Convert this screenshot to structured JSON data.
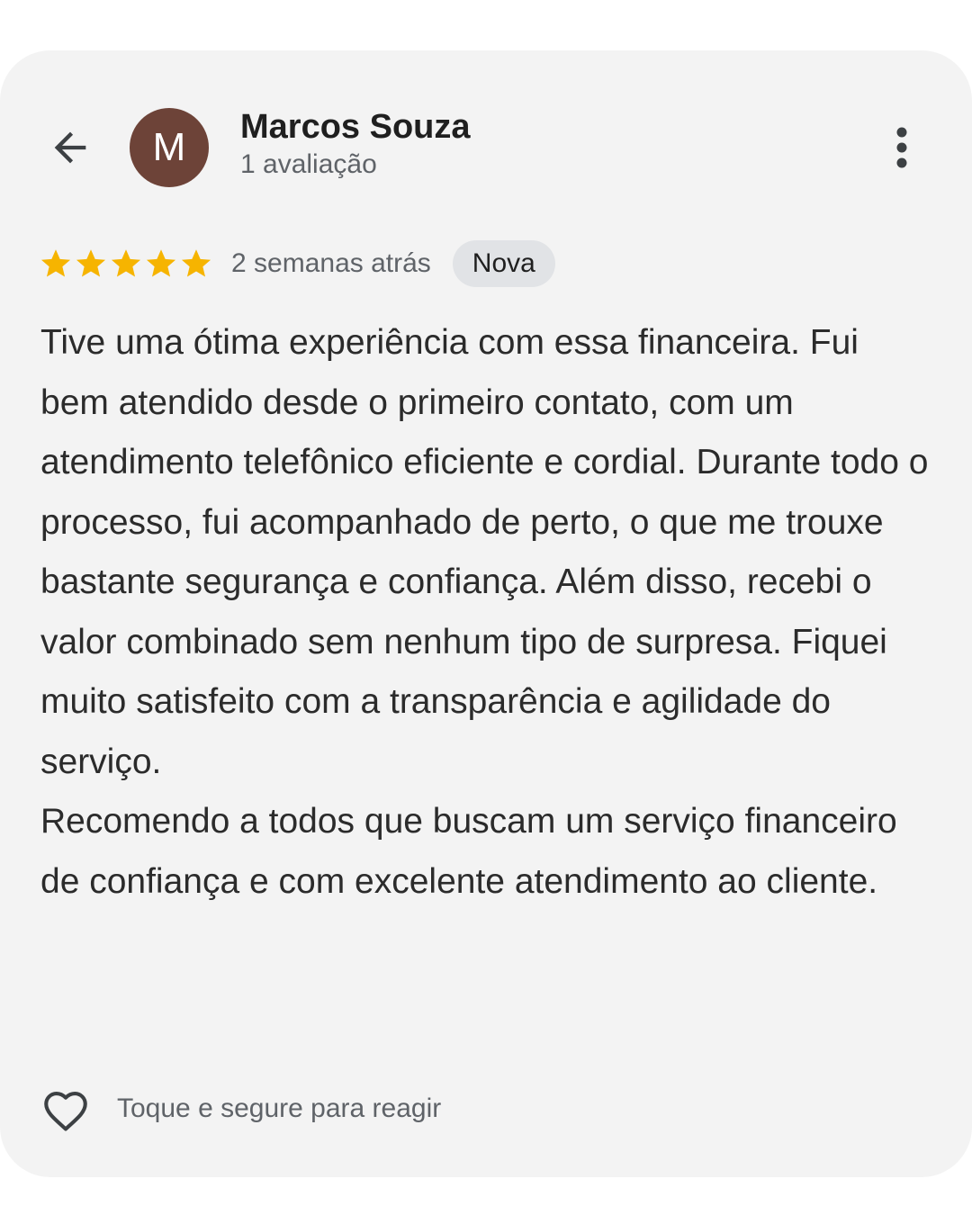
{
  "header": {
    "avatar_letter": "M",
    "avatar_color": "#6d4338",
    "reviewer_name": "Marcos Souza",
    "review_count": "1 avaliação"
  },
  "rating": {
    "stars": 5,
    "star_color": "#f6b400",
    "time_ago": "2 semanas atrás",
    "badge": "Nova"
  },
  "review": {
    "paragraph_1": "Tive uma ótima experiência com essa financeira. Fui bem atendido desde o primeiro contato, com um atendimento telefônico eficiente e cordial. Durante todo o processo, fui acompanhado de perto, o que me trouxe bastante segurança e confiança. Além disso, recebi o valor combinado sem nenhum tipo de surpresa. Fiquei muito satisfeito com a transparência e agilidade do serviço.",
    "paragraph_2": "Recomendo a todos que buscam um serviço financeiro de confiança e com excelente atendimento ao cliente."
  },
  "footer": {
    "react_label": "Toque e segure para reagir"
  },
  "icons": {
    "back": "arrow-left-icon",
    "more": "more-vert-icon",
    "star": "star-icon",
    "react": "heart-outline-icon"
  }
}
